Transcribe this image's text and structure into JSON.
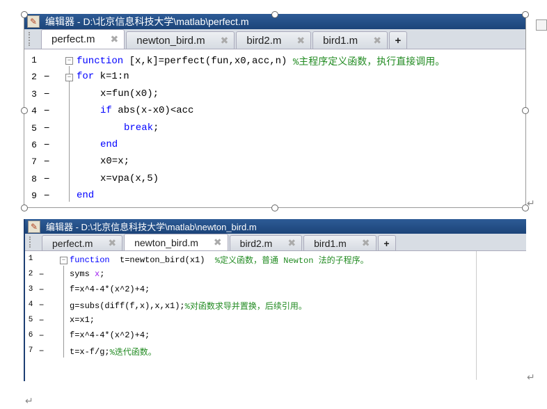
{
  "editor1": {
    "title": "编辑器 - D:\\北京信息科技大学\\matlab\\perfect.m",
    "tabs": [
      {
        "label": "perfect.m",
        "active": true
      },
      {
        "label": "newton_bird.m"
      },
      {
        "label": "bird2.m"
      },
      {
        "label": "bird1.m"
      }
    ],
    "new_tab": "+",
    "lines": [
      {
        "n": "1",
        "dash": "",
        "fold": "−",
        "indent": 0,
        "segs": [
          [
            "kw",
            "function"
          ],
          [
            "plain",
            " [x,k]=perfect(fun,x0,acc,n) "
          ],
          [
            "com",
            "%主程序定义函数，执行直接调用。"
          ]
        ]
      },
      {
        "n": "2",
        "dash": "−",
        "fold": "−",
        "indent": 0,
        "segs": [
          [
            "kw",
            "for"
          ],
          [
            "plain",
            " k=1:n"
          ]
        ]
      },
      {
        "n": "3",
        "dash": "−",
        "indent": 1,
        "segs": [
          [
            "plain",
            "x=fun(x0);"
          ]
        ]
      },
      {
        "n": "4",
        "dash": "−",
        "indent": 1,
        "segs": [
          [
            "kw",
            "if"
          ],
          [
            "plain",
            " abs(x-x0)<acc"
          ]
        ]
      },
      {
        "n": "5",
        "dash": "−",
        "indent": 2,
        "segs": [
          [
            "kw",
            "break"
          ],
          [
            "plain",
            ";"
          ]
        ]
      },
      {
        "n": "6",
        "dash": "−",
        "indent": 1,
        "segs": [
          [
            "kw",
            "end"
          ]
        ]
      },
      {
        "n": "7",
        "dash": "−",
        "indent": 1,
        "segs": [
          [
            "plain",
            "x0=x;"
          ]
        ]
      },
      {
        "n": "8",
        "dash": "−",
        "indent": 1,
        "segs": [
          [
            "plain",
            "x=vpa(x,5)"
          ]
        ]
      },
      {
        "n": "9",
        "dash": "−",
        "indent": 0,
        "segs": [
          [
            "kw",
            "end"
          ]
        ]
      }
    ]
  },
  "editor2": {
    "title": "编辑器 - D:\\北京信息科技大学\\matlab\\newton_bird.m",
    "tabs": [
      {
        "label": "perfect.m"
      },
      {
        "label": "newton_bird.m",
        "active": true
      },
      {
        "label": "bird2.m"
      },
      {
        "label": "bird1.m"
      }
    ],
    "new_tab": "+",
    "lines": [
      {
        "n": "1",
        "dash": "",
        "fold": "−",
        "indent": 0,
        "segs": [
          [
            "kw",
            "function"
          ],
          [
            "plain",
            "  t=newton_bird(x1)  "
          ],
          [
            "com",
            "%定义函数，普通 Newton 法的子程序。"
          ]
        ]
      },
      {
        "n": "2",
        "dash": "−",
        "indent": 0,
        "segs": [
          [
            "plain",
            "syms "
          ],
          [
            "sym",
            "x"
          ],
          [
            "plain",
            ";"
          ]
        ]
      },
      {
        "n": "3",
        "dash": "−",
        "indent": 0,
        "segs": [
          [
            "plain",
            "f=x^4-4*(x^2)+4;"
          ]
        ]
      },
      {
        "n": "4",
        "dash": "−",
        "indent": 0,
        "segs": [
          [
            "plain",
            "g=subs(diff(f,x),x,x1);"
          ],
          [
            "com",
            "%对函数求导并置换，后续引用。"
          ]
        ]
      },
      {
        "n": "5",
        "dash": "−",
        "indent": 0,
        "segs": [
          [
            "plain",
            "x=x1;"
          ]
        ]
      },
      {
        "n": "6",
        "dash": "−",
        "indent": 0,
        "segs": [
          [
            "plain",
            "f=x^4-4*(x^2)+4;"
          ]
        ]
      },
      {
        "n": "7",
        "dash": "−",
        "indent": 0,
        "segs": [
          [
            "plain",
            "t=x-f/g;"
          ],
          [
            "com",
            "%迭代函数。"
          ]
        ]
      }
    ]
  },
  "return_mark": "↵"
}
